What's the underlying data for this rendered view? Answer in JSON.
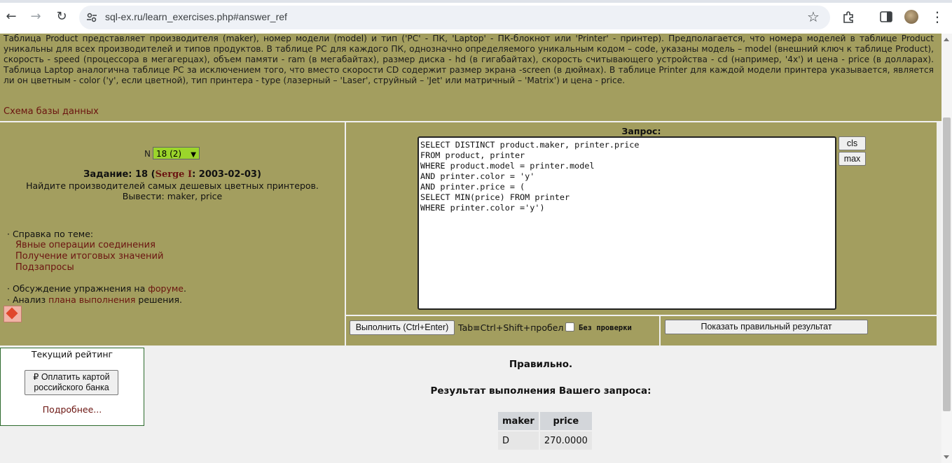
{
  "browser": {
    "url": "sql-ex.ru/learn_exercises.php#answer_ref",
    "back_icon": "←",
    "forward_icon": "→",
    "reload_icon": "↻",
    "star_icon": "☆",
    "menu_icon": "⋮"
  },
  "description": "Таблица Product представляет производителя (maker), номер модели (model) и тип ('PC' - ПК, 'Laptop' - ПК-блокнот или 'Printer' - принтер). Предполагается, что номера моделей в таблице Product уникальны для всех производителей и типов продуктов. В таблице PC для каждого ПК, однозначно определяемого уникальным кодом – code, указаны модель – model (внешний ключ к таблице Product), скорость - speed (процессора в мегагерцах), объем памяти - ram (в мегабайтах), размер диска - hd (в гигабайтах), скорость считывающего устройства - cd (например, '4x') и цена - price (в долларах). Таблица Laptop аналогична таблице PC за исключением того, что вместо скорости CD содержит размер экрана -screen (в дюймах). В таблице Printer для каждой модели принтера указывается, является ли он цветным - color ('y', если цветной), тип принтера - type (лазерный – 'Laser', струйный – 'Jet' или матричный – 'Matrix') и цена - price.",
  "schema_link": "Схема базы данных",
  "task": {
    "n_label": "N",
    "n_value": "18 (2)",
    "title_prefix": "Задание: 18 (",
    "author": "Serge I",
    "title_suffix": ": 2003-02-03)",
    "text": "Найдите производителей самых дешевых цветных принтеров. Вывести: maker, price"
  },
  "help": {
    "label": "· Справка по теме:",
    "links": [
      "Явные операции соединения",
      "Получение итоговых значений",
      "Подзапросы"
    ]
  },
  "forum": {
    "prefix": "· Обсуждение упражнения на ",
    "link": "форуме",
    "suffix": "."
  },
  "plan": {
    "prefix": "· Анализ ",
    "link": "плана выполнения",
    "suffix": " решения."
  },
  "query": {
    "label": "Запрос:",
    "sql": "SELECT DISTINCT product.maker, printer.price\nFROM product, printer\nWHERE product.model = printer.model\nAND printer.color = 'y'\nAND printer.price = (\nSELECT MIN(price) FROM printer\nWHERE printer.color ='y')",
    "cls_label": "cls",
    "max_label": "max"
  },
  "actions": {
    "execute_label": "Выполнить (Ctrl+Enter)",
    "tab_hint": "Tab≡Ctrl+Shift+пробел",
    "no_check_label": "Без проверки",
    "no_check_checked": false,
    "show_result_label": "Показать правильный результат"
  },
  "rating": {
    "title": "Текущий рейтинг",
    "pay_label": "₽ Оплатить картой российского банка",
    "more": "Подробнее..."
  },
  "result": {
    "status": "Правильно.",
    "title": "Результат выполнения Вашего запроса:",
    "columns": [
      "maker",
      "price"
    ],
    "rows": [
      [
        "D",
        "270.0000"
      ]
    ]
  }
}
